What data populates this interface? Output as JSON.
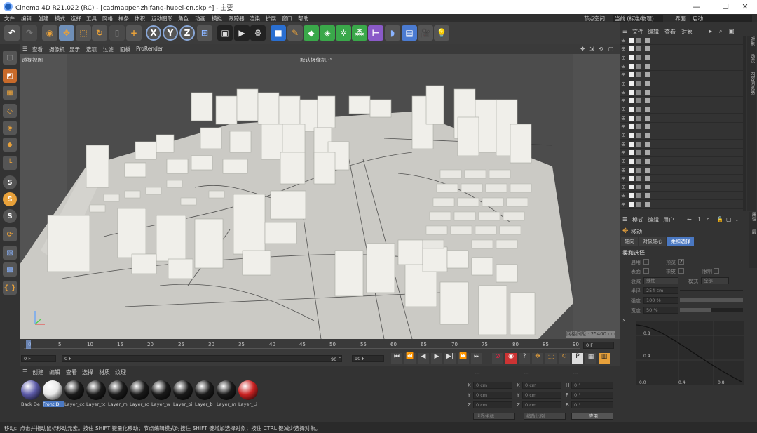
{
  "window": {
    "title": "Cinema 4D R21.022 (RC) - [cadmapper-zhifang-hubei-cn.skp *] - 主要",
    "minimize": "—",
    "maximize": "☐",
    "close": "✕"
  },
  "menubar": {
    "items": [
      "文件",
      "编辑",
      "创建",
      "模式",
      "选择",
      "工具",
      "网格",
      "样条",
      "体积",
      "运动图形",
      "角色",
      "动画",
      "模拟",
      "跟踪器",
      "渲染",
      "扩展",
      "窗口",
      "帮助"
    ],
    "node_space_label": "节点空间:",
    "node_space_value": "当前 (标准/物理)",
    "layout_label": "界面:",
    "layout_value": "启动"
  },
  "toolbar": {
    "x": "X",
    "y": "Y",
    "z": "Z"
  },
  "viewport_menu": {
    "items": [
      "查看",
      "摄像机",
      "显示",
      "选项",
      "过滤",
      "面板",
      "ProRender"
    ]
  },
  "viewport": {
    "name": "透视视图",
    "camera": "默认摄像机 ·°",
    "grid_spacing": "网格间距 : 25400 cm"
  },
  "timeline": {
    "ticks": [
      "0",
      "5",
      "10",
      "15",
      "20",
      "25",
      "30",
      "35",
      "40",
      "45",
      "50",
      "55",
      "60",
      "65",
      "70",
      "75",
      "80",
      "85",
      "90"
    ],
    "frame_end_box": "0 F",
    "current_frame": "0 F",
    "start_frame": "0 F",
    "range_end": "90 F",
    "end_frame": "90 F"
  },
  "material_manager": {
    "menu": [
      "创建",
      "编辑",
      "查看",
      "选择",
      "材质",
      "纹理"
    ],
    "materials": [
      {
        "label": "Back De",
        "color": "#5c5aa8"
      },
      {
        "label": "Front D",
        "color": "#e8e8e8"
      },
      {
        "label": "Layer_cc",
        "color": "#1a1a1a"
      },
      {
        "label": "Layer_tc",
        "color": "#1a1a1a"
      },
      {
        "label": "Layer_m",
        "color": "#1a1a1a"
      },
      {
        "label": "Layer_rc",
        "color": "#1a1a1a"
      },
      {
        "label": "Layer_w",
        "color": "#1a1a1a"
      },
      {
        "label": "Layer_pi",
        "color": "#1a1a1a"
      },
      {
        "label": "Layer_b",
        "color": "#1a1a1a"
      },
      {
        "label": "Layer_m",
        "color": "#1a1a1a"
      },
      {
        "label": "Layer_Li",
        "color": "#cc2222"
      }
    ]
  },
  "coordinates": {
    "header_a": "---",
    "header_b": "---",
    "header_c": "---",
    "rows": [
      {
        "a": "X",
        "av": "0 cm",
        "b": "X",
        "bv": "0 cm",
        "c": "H",
        "cv": "0 °"
      },
      {
        "a": "Y",
        "av": "0 cm",
        "b": "Y",
        "bv": "0 cm",
        "c": "P",
        "cv": "0 °"
      },
      {
        "a": "Z",
        "av": "0 cm",
        "b": "Z",
        "bv": "0 cm",
        "c": "B",
        "cv": "0 °"
      }
    ],
    "mode1": "世界坐标",
    "mode2": "缩放比例",
    "apply": "应用"
  },
  "object_manager": {
    "menu": [
      "文件",
      "编辑",
      "查看",
      "对象"
    ],
    "side_tabs": [
      "对象",
      "场次",
      "内容浏览器"
    ]
  },
  "attribute_manager": {
    "menu": [
      "模式",
      "编辑",
      "用户"
    ],
    "tool_name": "移动",
    "tabs": [
      "轴向",
      "对象轴心",
      "柔和选择"
    ],
    "section": "柔和选择",
    "opt_enable": "启用",
    "opt_preview": "预览",
    "opt_surface": "表面",
    "opt_rubber": "橡皮",
    "opt_restrict": "限制",
    "mode_label": "模式",
    "mode_value": "全部",
    "shape_label": "衰减",
    "shape_value": "线性",
    "radius_label": "半径",
    "radius_value": "254 cm",
    "strength_label": "强度",
    "strength_value": "100 %",
    "width_label": "宽度",
    "width_value": "50 %",
    "graph_y_ticks": [
      "0.8",
      "0.4"
    ],
    "graph_x_ticks": [
      "0.0",
      "0.4",
      "0.8"
    ],
    "side_tabs": [
      "属性",
      "层"
    ]
  },
  "status": {
    "text": "移动：点击并拖动鼠标移动元素。按住 SHIFT 键量化移动；节点编辑模式时按住 SHIFT 键增加选择对象；按住 CTRL 键减少选择对象。"
  }
}
